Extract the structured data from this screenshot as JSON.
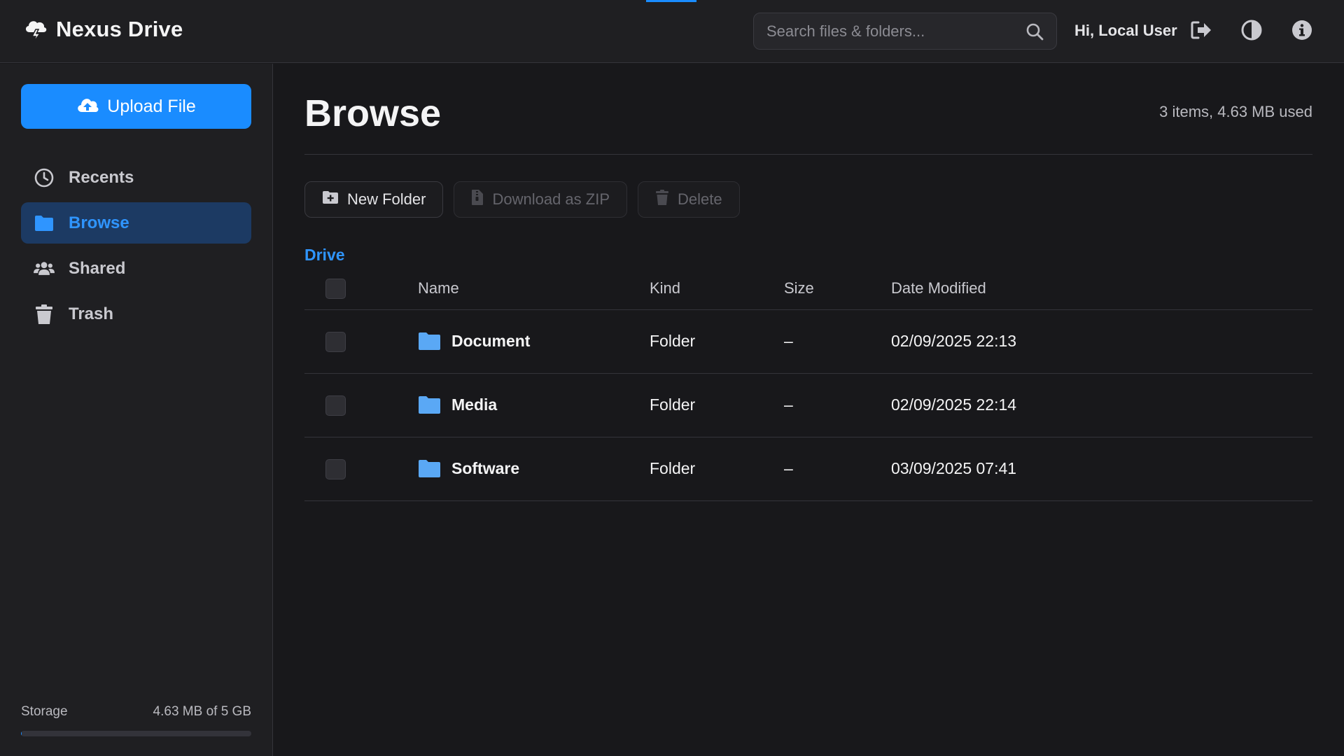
{
  "app": {
    "name": "Nexus Drive"
  },
  "header": {
    "search_placeholder": "Search files & folders...",
    "greeting": "Hi, Local User",
    "icons": [
      "logout-icon",
      "theme-toggle-icon",
      "info-icon"
    ]
  },
  "sidebar": {
    "upload_label": "Upload File",
    "items": [
      {
        "label": "Recents",
        "icon": "clock-icon",
        "active": false
      },
      {
        "label": "Browse",
        "icon": "folder-icon",
        "active": true
      },
      {
        "label": "Shared",
        "icon": "users-icon",
        "active": false
      },
      {
        "label": "Trash",
        "icon": "trash-icon",
        "active": false
      }
    ],
    "storage": {
      "label": "Storage",
      "value": "4.63 MB of 5 GB",
      "used_fraction": 0.001
    }
  },
  "main": {
    "title": "Browse",
    "usage": "3 items, 4.63 MB used",
    "toolbar": {
      "new_folder": "New Folder",
      "download_zip": "Download as ZIP",
      "delete": "Delete"
    },
    "breadcrumb": "Drive",
    "table": {
      "headers": {
        "name": "Name",
        "kind": "Kind",
        "size": "Size",
        "date": "Date Modified"
      },
      "rows": [
        {
          "name": "Document",
          "kind": "Folder",
          "size": "–",
          "date": "02/09/2025 22:13"
        },
        {
          "name": "Media",
          "kind": "Folder",
          "size": "–",
          "date": "02/09/2025 22:14"
        },
        {
          "name": "Software",
          "kind": "Folder",
          "size": "–",
          "date": "03/09/2025 07:41"
        }
      ]
    }
  },
  "colors": {
    "accent": "#1a8cff",
    "background": "#18181b",
    "panel": "#1f1f22",
    "folder": "#5aa8f5"
  }
}
